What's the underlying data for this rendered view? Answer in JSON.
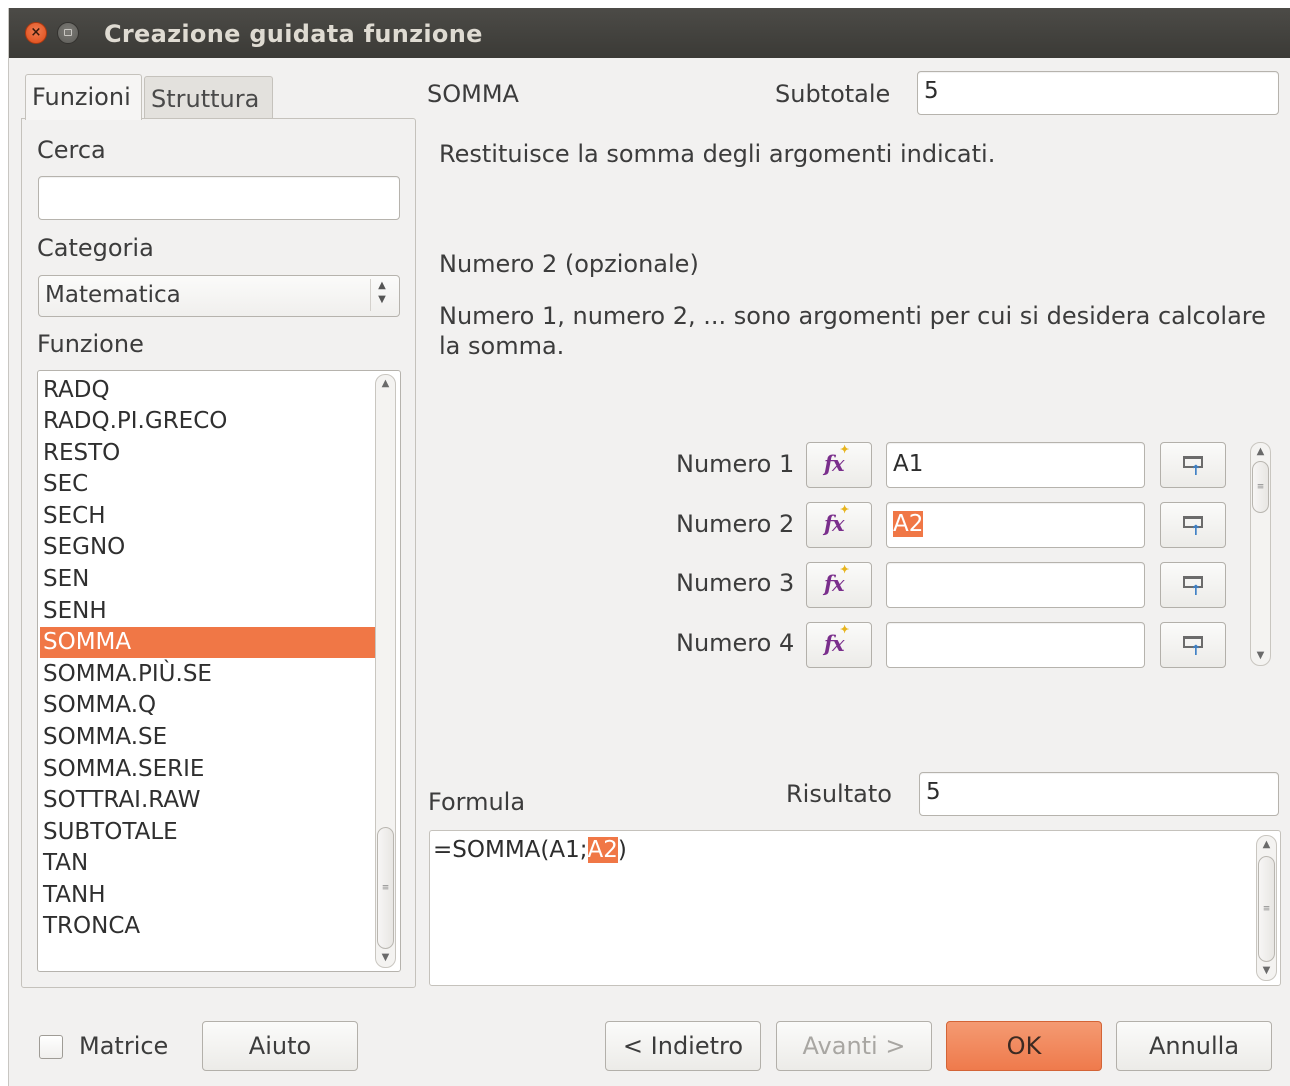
{
  "window": {
    "title": "Creazione guidata funzione"
  },
  "tabs": [
    {
      "label": "Funzioni"
    },
    {
      "label": "Struttura"
    }
  ],
  "search": {
    "label": "Cerca",
    "value": ""
  },
  "category": {
    "label": "Categoria",
    "value": "Matematica"
  },
  "function_list": {
    "label": "Funzione",
    "items": [
      "RADQ",
      "RADQ.PI.GRECO",
      "RESTO",
      "SEC",
      "SECH",
      "SEGNO",
      "SEN",
      "SENH",
      "SOMMA",
      "SOMMA.PIÙ.SE",
      "SOMMA.Q",
      "SOMMA.SE",
      "SOMMA.SERIE",
      "SOTTRAI.RAW",
      "SUBTOTALE",
      "TAN",
      "TANH",
      "TRONCA"
    ],
    "selected": "SOMMA"
  },
  "function": {
    "name": "SOMMA",
    "result_label": "Subtotale",
    "result_value": "5",
    "description": "Restituisce la somma degli argomenti indicati.",
    "arg_title": "Numero 2 (opzionale)",
    "arg_description": "Numero 1, numero 2, ... sono argomenti per cui si desidera calcolare la somma."
  },
  "arguments": [
    {
      "label": "Numero 1",
      "value": "A1"
    },
    {
      "label": "Numero 2",
      "value": "A2"
    },
    {
      "label": "Numero 3",
      "value": ""
    },
    {
      "label": "Numero 4",
      "value": ""
    }
  ],
  "formula": {
    "label": "Formula",
    "text_before": "=SOMMA(A1;",
    "text_selected": "A2",
    "text_after": ")",
    "result_label": "Risultato",
    "result_value": "5"
  },
  "footer": {
    "matrix_label": "Matrice",
    "matrix_checked": false,
    "help": "Aiuto",
    "back": "< Indietro",
    "next": "Avanti >",
    "ok": "OK",
    "cancel": "Annulla"
  },
  "colors": {
    "accent": "#f07746",
    "titlebar": "#3f3e3a",
    "close": "#e85a25"
  },
  "icons": [
    "close-icon",
    "minimize-icon",
    "function-wizard-icon",
    "shrink-icon"
  ]
}
